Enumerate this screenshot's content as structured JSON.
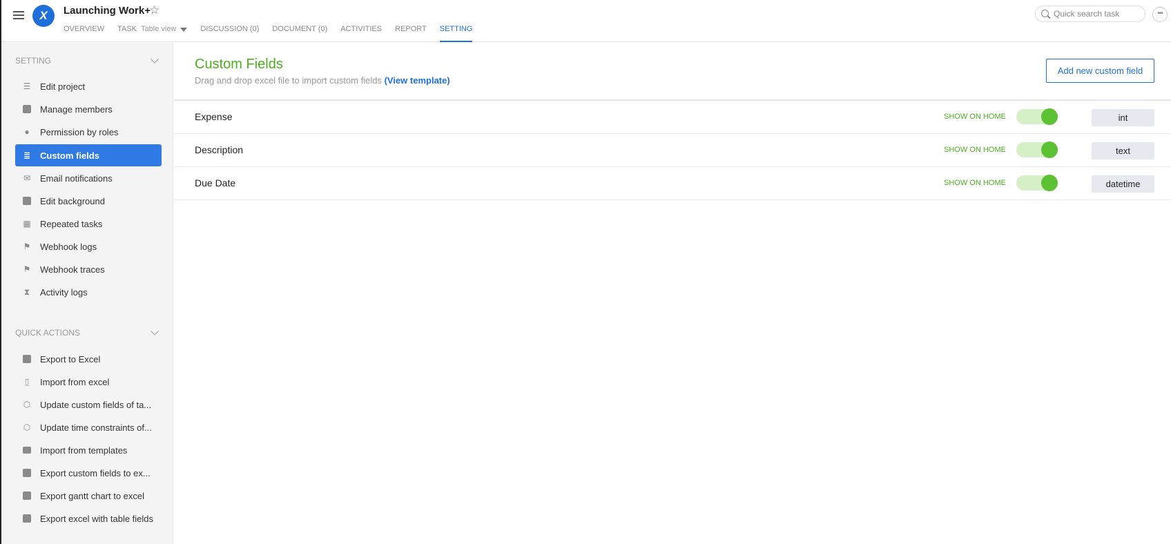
{
  "header": {
    "project_title": "Launching Work+",
    "logo_letter": "X",
    "tabs": [
      {
        "label": "OVERVIEW"
      },
      {
        "label": "TASK",
        "sub": "Table view"
      },
      {
        "label": "DISCUSSION (0)"
      },
      {
        "label": "DOCUMENT (0)"
      },
      {
        "label": "ACTIVITIES"
      },
      {
        "label": "REPORT"
      },
      {
        "label": "SETTING",
        "active": true
      }
    ],
    "search_placeholder": "Quick search task",
    "more_label": "•••"
  },
  "sidebar": {
    "setting_heading": "SETTING",
    "setting_items": [
      {
        "label": "Edit project",
        "icon": "list-icon"
      },
      {
        "label": "Manage members",
        "icon": "members-icon"
      },
      {
        "label": "Permission by roles",
        "icon": "permission-icon"
      },
      {
        "label": "Custom fields",
        "icon": "database-icon",
        "active": true
      },
      {
        "label": "Email notifications",
        "icon": "envelope-icon"
      },
      {
        "label": "Edit background",
        "icon": "edit-icon"
      },
      {
        "label": "Repeated tasks",
        "icon": "calendar-icon"
      },
      {
        "label": "Webhook logs",
        "icon": "flag-icon"
      },
      {
        "label": "Webhook traces",
        "icon": "flag-icon"
      },
      {
        "label": "Activity logs",
        "icon": "hourglass-icon"
      }
    ],
    "quick_heading": "QUICK ACTIONS",
    "quick_items": [
      {
        "label": "Export to Excel",
        "icon": "export-icon"
      },
      {
        "label": "Import from excel",
        "icon": "excel-file-icon"
      },
      {
        "label": "Update custom fields of ta...",
        "icon": "cube-icon"
      },
      {
        "label": "Update time constraints of...",
        "icon": "cube-icon"
      },
      {
        "label": "Import from templates",
        "icon": "folder-icon"
      },
      {
        "label": "Export custom fields to ex...",
        "icon": "export-icon"
      },
      {
        "label": "Export gantt chart to excel",
        "icon": "export-icon"
      },
      {
        "label": "Export excel with table fields",
        "icon": "export-icon"
      }
    ]
  },
  "main": {
    "title": "Custom Fields",
    "subtitle": "Drag and drop excel file to import custom fields ",
    "template_link": "(View template)",
    "add_button": "Add new custom field",
    "fields": [
      {
        "name": "Expense",
        "show_label": "SHOW ON HOME",
        "enabled": true,
        "type": "int"
      },
      {
        "name": "Description",
        "show_label": "SHOW ON HOME",
        "enabled": true,
        "type": "text"
      },
      {
        "name": "Due Date",
        "show_label": "SHOW ON HOME",
        "enabled": true,
        "type": "datetime"
      }
    ]
  },
  "colors": {
    "accent": "#1e6fd9",
    "active_nav": "#2f7ae5",
    "green": "#4caf1f",
    "toggle_track": "#d6efc7",
    "toggle_knob": "#5cc133"
  }
}
